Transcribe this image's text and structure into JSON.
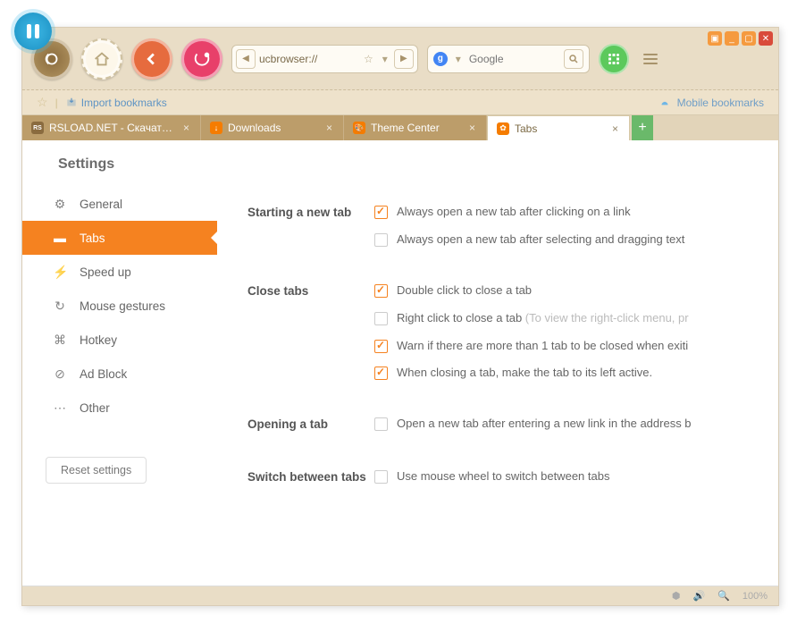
{
  "window": {
    "winctrls": [
      "▢",
      "_",
      "▢",
      "✕"
    ]
  },
  "topbar": {
    "url": "ucbrowser://",
    "search_placeholder": "Google"
  },
  "bookmarks": {
    "import_label": "Import bookmarks",
    "mobile_label": "Mobile bookmarks"
  },
  "tabs": [
    {
      "icon": "ti-rs",
      "label": "RSLOAD.NET - Скачать с…",
      "active": false
    },
    {
      "icon": "ti-dl",
      "label": "Downloads",
      "active": false
    },
    {
      "icon": "ti-th",
      "label": "Theme Center",
      "active": false
    },
    {
      "icon": "ti-tb",
      "label": "Tabs",
      "active": true
    }
  ],
  "settings": {
    "title": "Settings",
    "sidebar": [
      {
        "icon": "⚙",
        "label": "General"
      },
      {
        "icon": "▬",
        "label": "Tabs"
      },
      {
        "icon": "⚡",
        "label": "Speed up"
      },
      {
        "icon": "↻",
        "label": "Mouse gestures"
      },
      {
        "icon": "⌘",
        "label": "Hotkey"
      },
      {
        "icon": "⊘",
        "label": "Ad Block"
      },
      {
        "icon": "⋯",
        "label": "Other"
      }
    ],
    "active_index": 1,
    "reset_label": "Reset settings",
    "sections": [
      {
        "title": "Starting a new tab",
        "options": [
          {
            "checked": true,
            "text": "Always open a new tab after clicking on a link"
          },
          {
            "checked": false,
            "text": "Always open a new tab after selecting and dragging text"
          }
        ]
      },
      {
        "title": "Close tabs",
        "options": [
          {
            "checked": true,
            "text": "Double click to close a tab"
          },
          {
            "checked": false,
            "text": "Right click to close a tab",
            "hint": "(To view the right-click menu, pr"
          },
          {
            "checked": true,
            "text": "Warn if there are more than 1 tab to be closed when exiti"
          },
          {
            "checked": true,
            "text": "When closing a tab, make the tab to its left active."
          }
        ]
      },
      {
        "title": "Opening a tab",
        "options": [
          {
            "checked": false,
            "text": "Open a new tab after entering a new link in the address b"
          }
        ]
      },
      {
        "title": "Switch between tabs",
        "options": [
          {
            "checked": false,
            "text": "Use mouse wheel to switch between tabs"
          }
        ]
      }
    ]
  },
  "status": {
    "zoom": "100%"
  }
}
